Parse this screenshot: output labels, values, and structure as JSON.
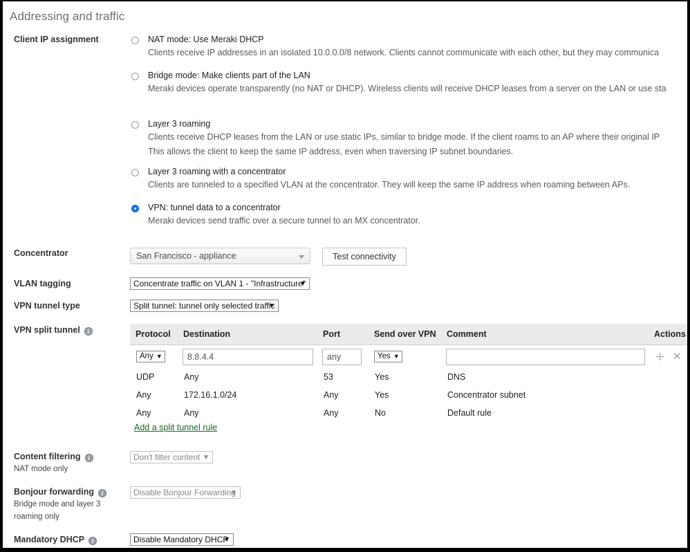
{
  "section": {
    "title": "Addressing and traffic"
  },
  "client_ip": {
    "label": "Client IP assignment",
    "options": [
      {
        "id": "nat-mode",
        "title": "NAT mode: Use Meraki DHCP",
        "desc": "Clients receive IP addresses in an isolated 10.0.0.0/8 network. Clients cannot communicate with each other, but they may communica",
        "selected": false
      },
      {
        "id": "bridge-mode",
        "title": "Bridge mode: Make clients part of the LAN",
        "desc": "Meraki devices operate transparently (no NAT or DHCP). Wireless clients will receive DHCP leases from a server on the LAN or use sta",
        "selected": false
      },
      {
        "id": "layer3-roaming",
        "title": "Layer 3 roaming",
        "desc": "Clients receive DHCP leases from the LAN or use static IPs, similar to bridge mode. If the client roams to an AP where their original IP",
        "desc2": "This allows the client to keep the same IP address, even when traversing IP subnet boundaries.",
        "selected": false
      },
      {
        "id": "layer3-roaming-concentrator",
        "title": "Layer 3 roaming with a concentrator",
        "desc": "Clients are tunneled to a specified VLAN at the concentrator. They will keep the same IP address when roaming between APs.",
        "selected": false
      },
      {
        "id": "vpn-tunnel",
        "title": "VPN: tunnel data to a concentrator",
        "desc": "Meraki devices send traffic over a secure tunnel to an MX concentrator.",
        "selected": true
      }
    ]
  },
  "concentrator": {
    "label": "Concentrator",
    "value": "San Francisco - appliance",
    "test_button": "Test connectivity"
  },
  "vlan_tagging": {
    "label": "VLAN tagging",
    "value": "Concentrate traffic on VLAN 1 - \"Infrastructure\""
  },
  "vpn_tunnel_type": {
    "label": "VPN tunnel type",
    "value": "Split tunnel: tunnel only selected traffic"
  },
  "split_tunnel": {
    "label": "VPN split tunnel",
    "columns": [
      "Protocol",
      "Destination",
      "Port",
      "Send over VPN",
      "Comment",
      "Actions"
    ],
    "new_row": {
      "protocol": "Any",
      "destination": "8.8.4.4",
      "port": "any",
      "send_over_vpn": "Yes",
      "comment": ""
    },
    "rows": [
      {
        "protocol": "UDP",
        "destination": "Any",
        "port": "53",
        "send_over_vpn": "Yes",
        "comment": "DNS"
      },
      {
        "protocol": "Any",
        "destination": "172.16.1.0/24",
        "port": "Any",
        "send_over_vpn": "Yes",
        "comment": "Concentrator subnet"
      },
      {
        "protocol": "Any",
        "destination": "Any",
        "port": "Any",
        "send_over_vpn": "No",
        "comment": "Default rule"
      }
    ],
    "add_link": "Add a split tunnel rule"
  },
  "content_filtering": {
    "label": "Content filtering",
    "sublabel": "NAT mode only",
    "value": "Don't filter content"
  },
  "bonjour": {
    "label": "Bonjour forwarding",
    "sublabel_line1": "Bridge mode and layer 3",
    "sublabel_line2": "roaming only",
    "value": "Disable Bonjour Forwarding"
  },
  "mandatory_dhcp": {
    "label": "Mandatory DHCP",
    "value": "Disable Mandatory DHCP"
  },
  "colors": {
    "accent": "#1a73e8",
    "link": "#19691f",
    "header_bg": "#ebebeb",
    "title": "#6d6f73"
  }
}
